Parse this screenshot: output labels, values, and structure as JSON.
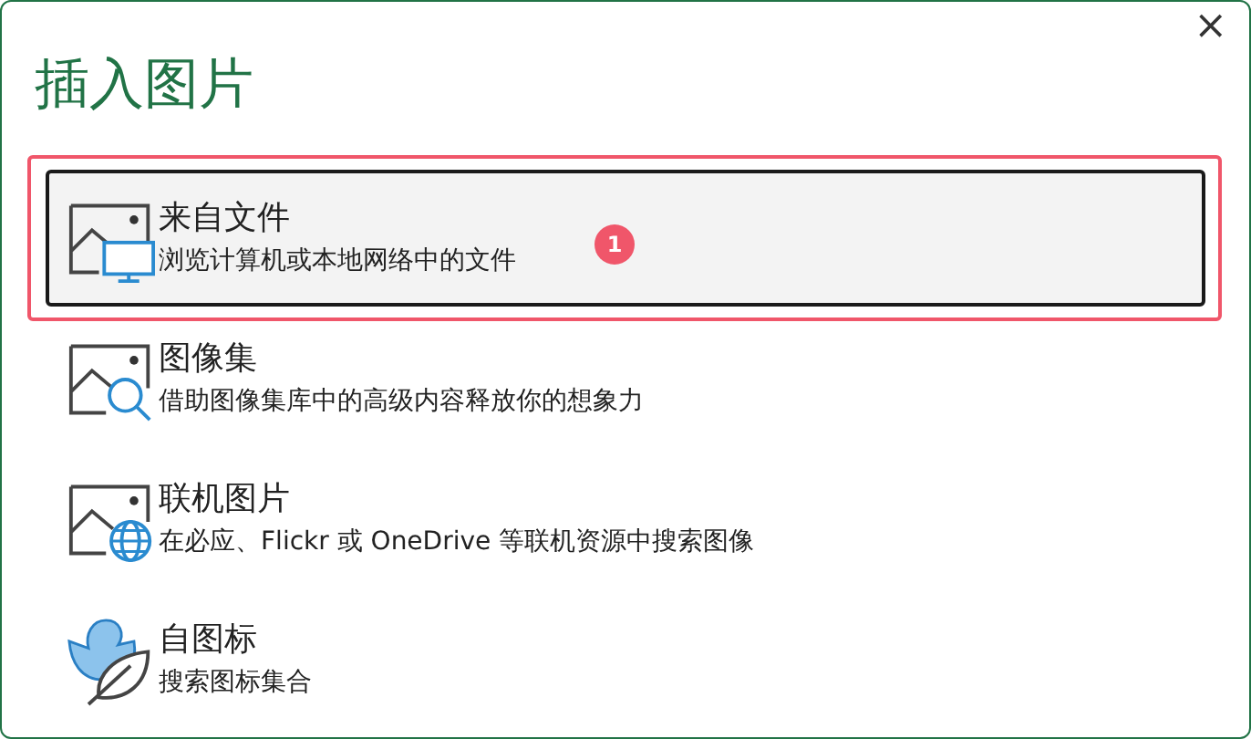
{
  "window": {
    "title": "插入图片",
    "close": "×"
  },
  "options": [
    {
      "kind": "monitor",
      "title": "来自文件",
      "description": "浏览计算机或本地网络中的文件",
      "selected": true,
      "highlighted": true,
      "badge": "1"
    },
    {
      "kind": "search",
      "title": "图像集",
      "description": "借助图像集库中的高级内容释放你的想象力",
      "selected": false,
      "highlighted": false
    },
    {
      "kind": "globe",
      "title": "联机图片",
      "description": "在必应、Flickr 或 OneDrive 等联机资源中搜索图像",
      "selected": false,
      "highlighted": false
    },
    {
      "kind": "icons",
      "title": "自图标",
      "description": "搜索图标集合",
      "selected": false,
      "highlighted": false
    }
  ]
}
